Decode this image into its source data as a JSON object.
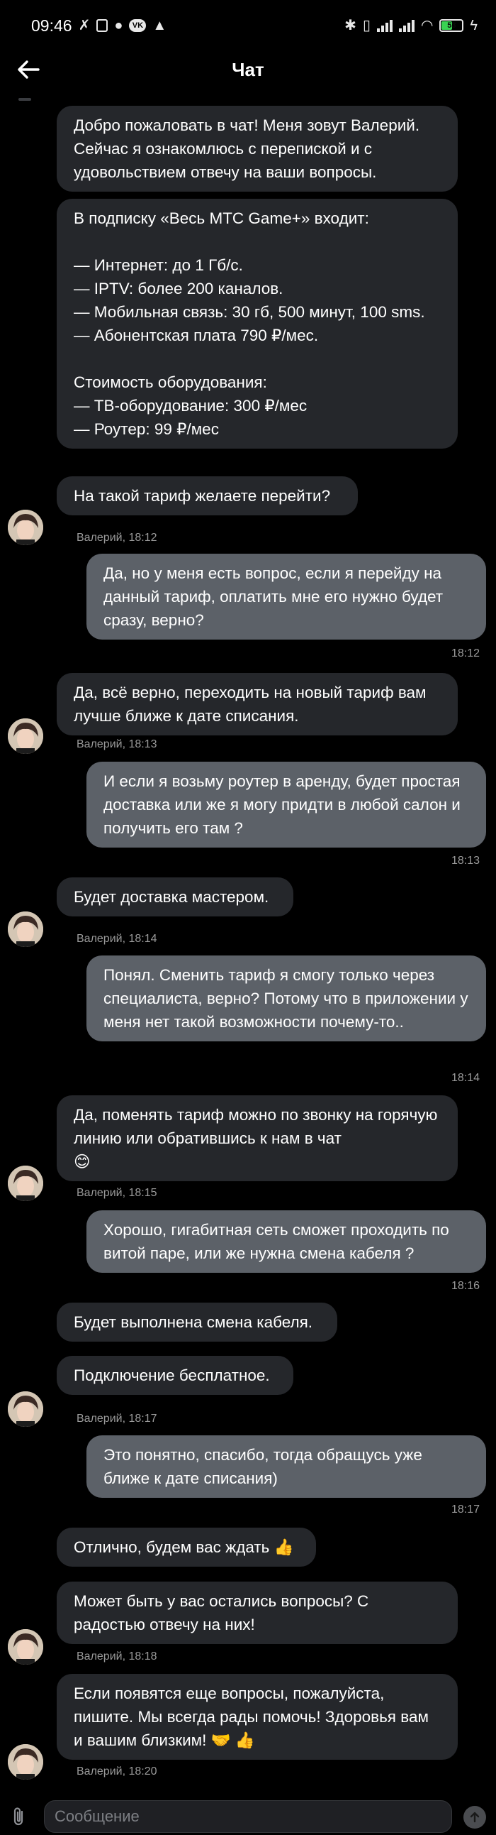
{
  "status_bar": {
    "time": "09:46",
    "battery_level": "53"
  },
  "header": {
    "title": "Чат"
  },
  "colors": {
    "background": "#000000",
    "incoming_bubble": "#25272b",
    "outgoing_bubble": "#5c6168",
    "meta": "#9a9a9a"
  },
  "messages": [
    {
      "side": "in",
      "text": "Добро пожаловать в чат! Меня зовут Валерий. Сейчас я ознакомлюсь с перепиской и с удовольствием отвечу на ваши вопросы."
    },
    {
      "side": "in",
      "text": "В подписку «Весь МТС Game+» входит:\n\n— Интернет: до 1 Гб/с.\n— IPTV: более 200 каналов.\n— Мобильная связь: 30 гб, 500 минут, 100 sms.\n— Абонентская плата 790 ₽/мес.\n\nСтоимость оборудования:\n— ТВ-оборудование: 300 ₽/мес\n— Роутер: 99 ₽/мес"
    },
    {
      "side": "in",
      "text": "На такой тариф желаете перейти?"
    },
    {
      "side": "out",
      "text": "Да, но у меня есть вопрос, если я перейду на данный тариф, оплатить мне его нужно будет сразу, верно?"
    },
    {
      "side": "in",
      "text": "Да, всё верно, переходить на новый тариф вам лучше ближе к дате списания."
    },
    {
      "side": "out",
      "text": "И если я возьму роутер в аренду, будет простая доставка или же я могу придти в любой салон и получить его там ?"
    },
    {
      "side": "in",
      "text": "Будет доставка мастером."
    },
    {
      "side": "out",
      "text": "Понял. Сменить тариф я смогу только через специалиста, верно? Потому что в приложении у меня нет такой возможности почему-то.."
    },
    {
      "side": "in",
      "text": "Да, поменять тариф можно по звонку на горячую линию или обратившись к нам в чат\n😊"
    },
    {
      "side": "out",
      "text": "Хорошо, гигабитная сеть сможет проходить по витой паре, или же нужна смена кабеля ?"
    },
    {
      "side": "in",
      "text": "Будет выполнена смена кабеля."
    },
    {
      "side": "in",
      "text": "Подключение бесплатное."
    },
    {
      "side": "out",
      "text": "Это понятно, спасибо, тогда обращусь уже ближе к дате списания)"
    },
    {
      "side": "in",
      "text": "Отлично, будем вас ждать 👍"
    },
    {
      "side": "in",
      "text": "Может быть у вас остались вопросы? С радостью отвечу на них!"
    },
    {
      "side": "in",
      "text": "Если появятся еще вопросы, пожалуйста, пишите. Мы всегда рады помочь! Здоровья вам и вашим близким! 🤝 👍"
    }
  ],
  "meta": [
    "Валерий, 18:12",
    "18:12",
    "Валерий, 18:13",
    "18:13",
    "Валерий, 18:14",
    "18:14",
    "Валерий, 18:15",
    "18:16",
    "Валерий, 18:17",
    "18:17",
    "Валерий, 18:18",
    "Валерий, 18:20"
  ],
  "composer": {
    "placeholder": "Сообщение"
  }
}
